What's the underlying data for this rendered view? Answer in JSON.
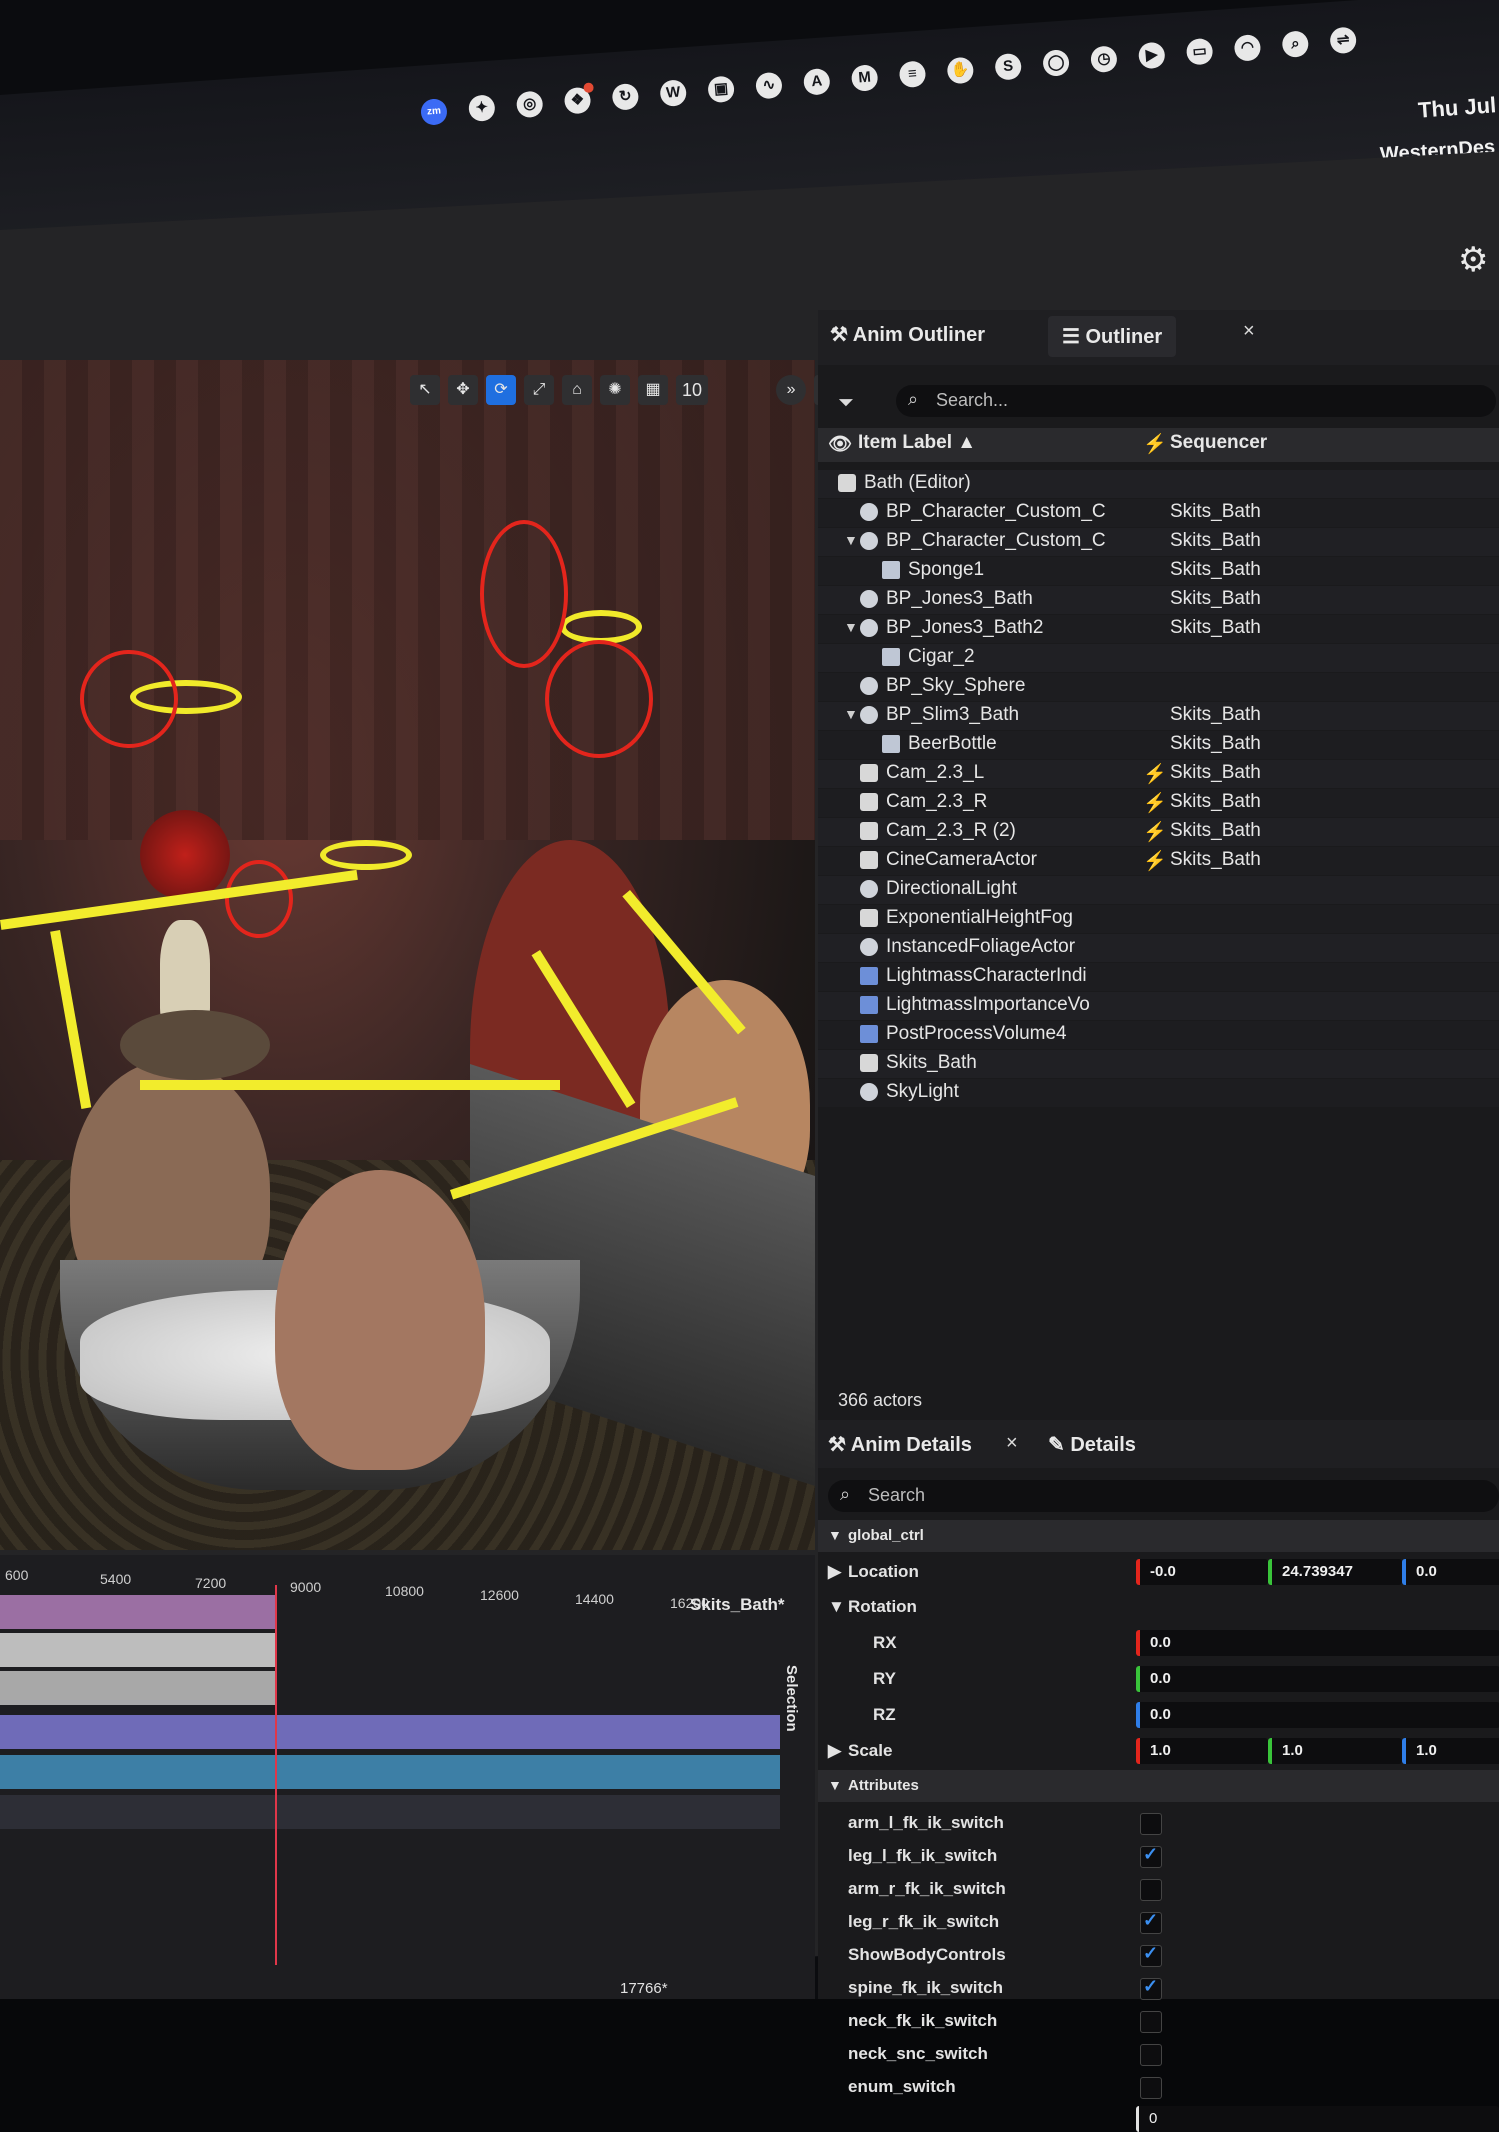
{
  "menubar": {
    "clock": "Thu Jul",
    "user": "WesternDes",
    "icons": [
      "zoom-icon",
      "figma-icon",
      "chrome-icon",
      "dropbox-icon",
      "sync-icon",
      "w-icon",
      "window-icon",
      "graph-icon",
      "a-icon",
      "m-icon",
      "stack-icon",
      "hand-icon",
      "s-icon",
      "circle-icon",
      "clock-icon",
      "play-icon",
      "battery-icon",
      "wifi-icon",
      "search-icon",
      "toggle-icon"
    ],
    "zoom_label": "zm"
  },
  "viewport": {
    "grid_size": "10"
  },
  "timeline": {
    "ticks": [
      "600",
      "5400",
      "7200",
      "9000",
      "10800",
      "12600",
      "14400",
      "16200"
    ],
    "sequence_name": "Skits_Bath*",
    "selection_label": "Selection",
    "frame_readout": "17766*"
  },
  "outliner": {
    "tab_anim": "Anim Outliner",
    "tab_outliner": "Outliner",
    "close": "×",
    "search_placeholder": "Search...",
    "col_label": "Item Label ▲",
    "col_sequencer": "Sequencer",
    "rows": [
      {
        "label": "Bath (Editor)",
        "indent": 0,
        "icon": "level",
        "seq": "",
        "bolt": false,
        "arrow": ""
      },
      {
        "label": "BP_Character_Custom_C",
        "indent": 1,
        "icon": "pawn",
        "seq": "Skits_Bath",
        "bolt": false,
        "arrow": ""
      },
      {
        "label": "BP_Character_Custom_C",
        "indent": 1,
        "icon": "pawn",
        "seq": "Skits_Bath",
        "bolt": false,
        "arrow": "▼"
      },
      {
        "label": "Sponge1",
        "indent": 2,
        "icon": "cube",
        "seq": "Skits_Bath",
        "bolt": false,
        "arrow": ""
      },
      {
        "label": "BP_Jones3_Bath",
        "indent": 1,
        "icon": "pawn",
        "seq": "Skits_Bath",
        "bolt": false,
        "arrow": ""
      },
      {
        "label": "BP_Jones3_Bath2",
        "indent": 1,
        "icon": "pawn",
        "seq": "Skits_Bath",
        "bolt": false,
        "arrow": "▼"
      },
      {
        "label": "Cigar_2",
        "indent": 2,
        "icon": "cube",
        "seq": "",
        "bolt": false,
        "arrow": ""
      },
      {
        "label": "BP_Sky_Sphere",
        "indent": 1,
        "icon": "pawn",
        "seq": "",
        "bolt": false,
        "arrow": ""
      },
      {
        "label": "BP_Slim3_Bath",
        "indent": 1,
        "icon": "pawn",
        "seq": "Skits_Bath",
        "bolt": false,
        "arrow": "▼"
      },
      {
        "label": "BeerBottle",
        "indent": 2,
        "icon": "cube",
        "seq": "Skits_Bath",
        "bolt": false,
        "arrow": ""
      },
      {
        "label": "Cam_2.3_L",
        "indent": 1,
        "icon": "cam",
        "seq": "Skits_Bath",
        "bolt": true,
        "arrow": ""
      },
      {
        "label": "Cam_2.3_R",
        "indent": 1,
        "icon": "cam",
        "seq": "Skits_Bath",
        "bolt": true,
        "arrow": ""
      },
      {
        "label": "Cam_2.3_R (2)",
        "indent": 1,
        "icon": "cam",
        "seq": "Skits_Bath",
        "bolt": true,
        "arrow": ""
      },
      {
        "label": "CineCameraActor",
        "indent": 1,
        "icon": "cam",
        "seq": "Skits_Bath",
        "bolt": true,
        "arrow": ""
      },
      {
        "label": "DirectionalLight",
        "indent": 1,
        "icon": "sun",
        "seq": "",
        "bolt": false,
        "arrow": ""
      },
      {
        "label": "ExponentialHeightFog",
        "indent": 1,
        "icon": "fog",
        "seq": "",
        "bolt": false,
        "arrow": ""
      },
      {
        "label": "InstancedFoliageActor",
        "indent": 1,
        "icon": "pawn",
        "seq": "",
        "bolt": false,
        "arrow": ""
      },
      {
        "label": "LightmassCharacterIndi",
        "indent": 1,
        "icon": "blue",
        "seq": "",
        "bolt": false,
        "arrow": ""
      },
      {
        "label": "LightmassImportanceVo",
        "indent": 1,
        "icon": "blue",
        "seq": "",
        "bolt": false,
        "arrow": ""
      },
      {
        "label": "PostProcessVolume4",
        "indent": 1,
        "icon": "blue",
        "seq": "",
        "bolt": false,
        "arrow": ""
      },
      {
        "label": "Skits_Bath",
        "indent": 1,
        "icon": "clapper",
        "seq": "",
        "bolt": false,
        "arrow": ""
      },
      {
        "label": "SkyLight",
        "indent": 1,
        "icon": "sky",
        "seq": "",
        "bolt": false,
        "arrow": ""
      }
    ],
    "actors_count": "366 actors"
  },
  "details": {
    "tab_anim_details": "Anim Details",
    "tab_details": "Details",
    "close": "×",
    "search_placeholder": "Search",
    "sections": {
      "global_ctrl": "global_ctrl",
      "location": "Location",
      "rotation": "Rotation",
      "scale": "Scale",
      "attributes": "Attributes"
    },
    "location": {
      "x": "-0.0",
      "y": "24.739347",
      "z": "0.0"
    },
    "rotation": {
      "rx_label": "RX",
      "ry_label": "RY",
      "rz_label": "RZ",
      "rx": "0.0",
      "ry": "0.0",
      "rz": "0.0"
    },
    "scale": {
      "x": "1.0",
      "y": "1.0",
      "z": "1.0"
    },
    "attributes": [
      {
        "name": "arm_l_fk_ik_switch",
        "checked": false
      },
      {
        "name": "leg_l_fk_ik_switch",
        "checked": true
      },
      {
        "name": "arm_r_fk_ik_switch",
        "checked": false
      },
      {
        "name": "leg_r_fk_ik_switch",
        "checked": true
      },
      {
        "name": "ShowBodyControls",
        "checked": true
      },
      {
        "name": "spine_fk_ik_switch",
        "checked": true
      },
      {
        "name": "neck_fk_ik_switch",
        "checked": false
      },
      {
        "name": "neck_snc_switch",
        "checked": false
      },
      {
        "name": "enum_switch",
        "checked": false
      }
    ],
    "enum_value": "0"
  }
}
